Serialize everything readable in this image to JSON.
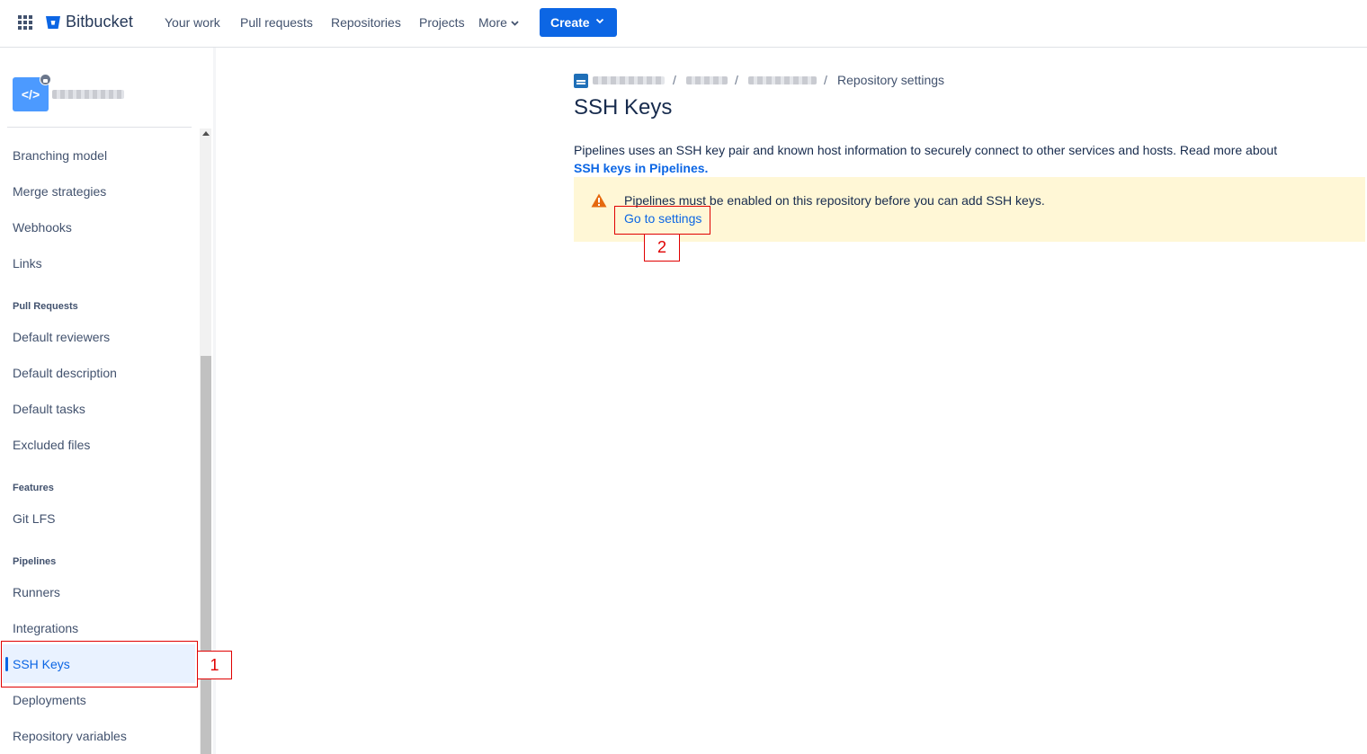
{
  "nav": {
    "logo_text": "Bitbucket",
    "items": [
      "Your work",
      "Pull requests",
      "Repositories",
      "Projects",
      "More"
    ],
    "create_label": "Create"
  },
  "sidebar": {
    "repo_icon_glyph": "</>",
    "items_top": [
      "Branching model",
      "Merge strategies",
      "Webhooks",
      "Links"
    ],
    "section_pull_requests": "Pull Requests",
    "items_pr": [
      "Default reviewers",
      "Default description",
      "Default tasks",
      "Excluded files"
    ],
    "section_features": "Features",
    "items_features": [
      "Git LFS"
    ],
    "section_pipelines": "Pipelines",
    "items_pipelines": [
      "Runners",
      "Integrations",
      "SSH Keys",
      "Deployments",
      "Repository variables"
    ],
    "active_item": "SSH Keys"
  },
  "breadcrumb": {
    "separator": "/",
    "last": "Repository settings"
  },
  "main": {
    "title": "SSH Keys",
    "description": "Pipelines uses an SSH key pair and known host information to securely connect to other services and hosts. Read more about",
    "description_link": "SSH keys in Pipelines.",
    "warning_text": "Pipelines must be enabled on this repository before you can add SSH keys.",
    "warning_link": "Go to settings"
  },
  "annotations": [
    "1",
    "2"
  ],
  "colors": {
    "brand_blue": "#0c66e4",
    "warning_bg": "#fff7d6",
    "warning_icon": "#e56910",
    "annotation_red": "#e00000"
  }
}
